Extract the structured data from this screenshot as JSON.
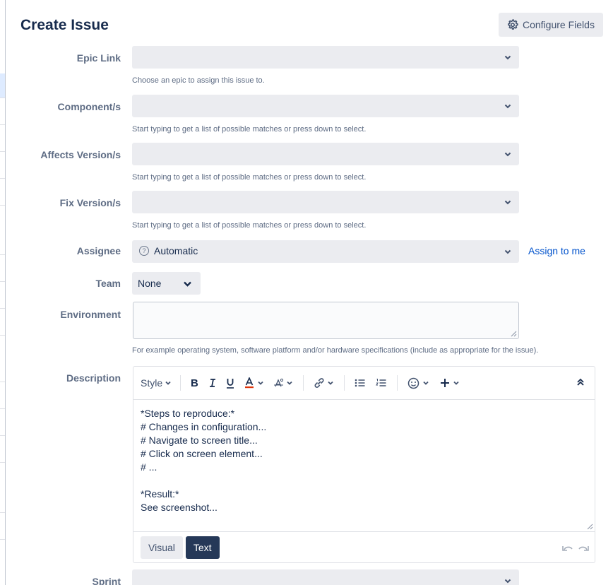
{
  "header": {
    "title": "Create Issue",
    "configure_label": "Configure Fields"
  },
  "fields": {
    "epic_link": {
      "label": "Epic Link",
      "hint": "Choose an epic to assign this issue to."
    },
    "components": {
      "label": "Component/s",
      "hint": "Start typing to get a list of possible matches or press down to select."
    },
    "affects_version": {
      "label": "Affects Version/s",
      "hint": "Start typing to get a list of possible matches or press down to select."
    },
    "fix_version": {
      "label": "Fix Version/s",
      "hint": "Start typing to get a list of possible matches or press down to select."
    },
    "assignee": {
      "label": "Assignee",
      "value": "Automatic",
      "assign_link": "Assign to me"
    },
    "team": {
      "label": "Team",
      "value": "None"
    },
    "environment": {
      "label": "Environment",
      "hint": "For example operating system, software platform and/or hardware specifications (include as appropriate for the issue)."
    },
    "description": {
      "label": "Description",
      "toolbar": {
        "style": "Style"
      },
      "lines": [
        "*Steps to reproduce:*",
        "# Changes in configuration...",
        "# Navigate to screen title...",
        "# Click on screen element...",
        "# ...",
        "",
        "*Result:*",
        "See screenshot..."
      ],
      "modes": {
        "visual": "Visual",
        "text": "Text"
      }
    },
    "sprint": {
      "label": "Sprint"
    }
  },
  "colors": {
    "link": "#0052cc",
    "field_bg": "#ebecf0",
    "active_mode": "#253858",
    "underline_red": "#de350b"
  }
}
